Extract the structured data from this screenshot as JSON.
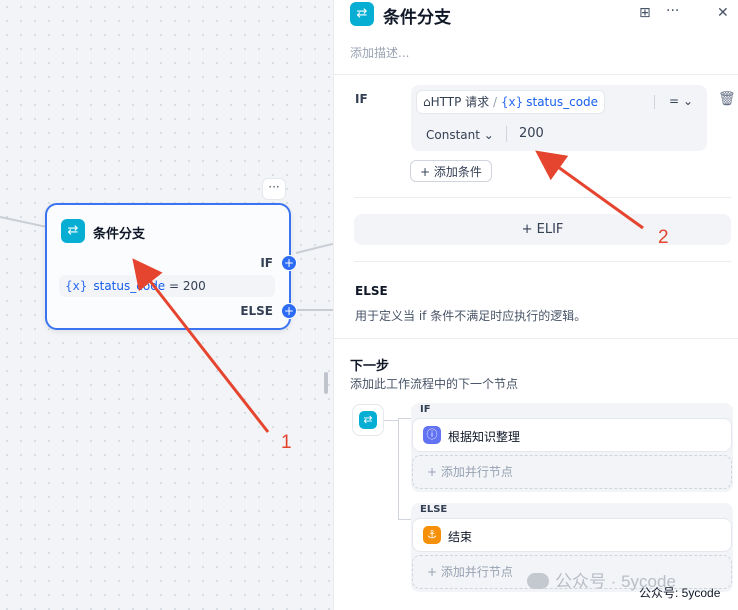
{
  "canvas": {
    "node": {
      "more_label": "···",
      "icon": "branch-icon",
      "title": "条件分支",
      "if_port": "IF",
      "else_port": "ELSE",
      "port_symbol": "+",
      "condition": {
        "var_icon": "{x}",
        "var_name": "status_code",
        "operator": "=",
        "value": "200"
      }
    }
  },
  "panel": {
    "icon": "branch-icon",
    "title": "条件分支",
    "description_placeholder": "添加描述...",
    "tools": {
      "book": "⊞",
      "more": "···",
      "close": "✕"
    },
    "if_section": {
      "label": "IF",
      "condition": {
        "source_icon": "⌂",
        "source_node": "HTTP 请求",
        "slash": "/",
        "var_icon": "{x}",
        "var_name": "status_code",
        "operator": "=",
        "operator_caret": "⌄",
        "value_type": "Constant",
        "value_type_caret": "⌄",
        "value": "200"
      },
      "add_condition": "+ 添加条件",
      "delete_icon": "🗑"
    },
    "elif_button": "+ ELIF",
    "else_section": {
      "label": "ELSE",
      "description": "用于定义当 if 条件不满足时应执行的逻辑。"
    },
    "next_step": {
      "title": "下一步",
      "description": "添加此工作流程中的下一个节点",
      "branches": [
        {
          "label": "IF",
          "node_label": "根据知识整理",
          "node_icon": "ⓘ",
          "node_color": "#6172f3",
          "add_parallel": "+  添加并行节点"
        },
        {
          "label": "ELSE",
          "node_label": "结束",
          "node_icon": "⚓",
          "node_color": "#f79009",
          "add_parallel": "+  添加并行节点"
        }
      ]
    }
  },
  "annotations": {
    "arrow_1_label": "1",
    "arrow_2_label": "2",
    "color": "#e5452e"
  },
  "watermark": {
    "main": "公众号 · 5ycode",
    "sub": "公众号:  5ycode"
  }
}
